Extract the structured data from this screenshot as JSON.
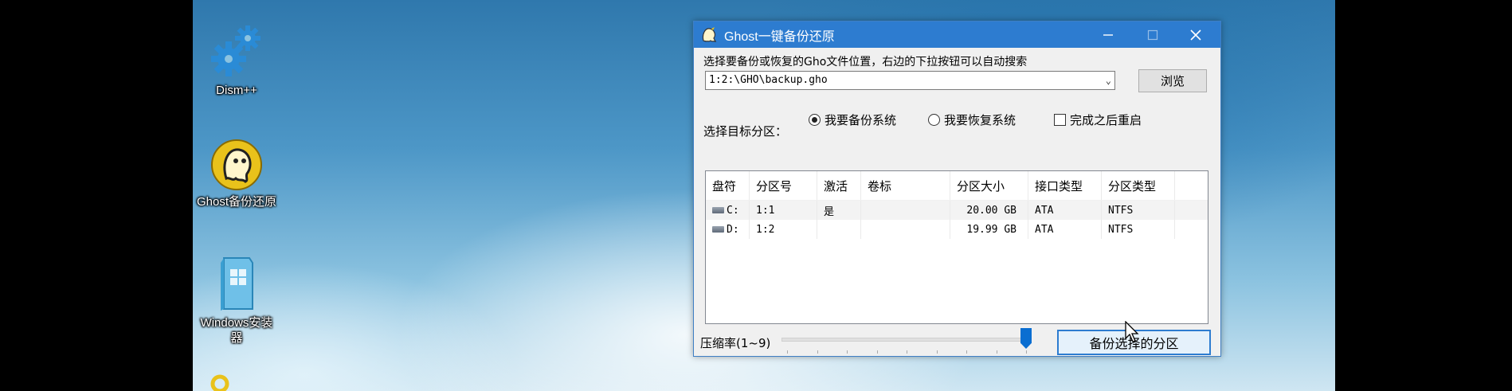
{
  "desktop": {
    "icons": [
      {
        "name": "dism",
        "label": "Dism++"
      },
      {
        "name": "ghost",
        "label": "Ghost备份还原"
      },
      {
        "name": "windows-installer",
        "label": "Windows安装器"
      }
    ]
  },
  "window": {
    "title": "Ghost一键备份还原",
    "prompt": "选择要备份或恢复的Gho文件位置，右边的下拉按钮可以自动搜索",
    "path_value": "1:2:\\GHO\\backup.gho",
    "browse_label": "浏览",
    "target_label": "选择目标分区：",
    "options": {
      "backup": "我要备份系统",
      "restore": "我要恢复系统",
      "reboot": "完成之后重启",
      "selected": "backup"
    },
    "columns": [
      "盘符",
      "分区号",
      "激活",
      "卷标",
      "分区大小",
      "接口类型",
      "分区类型"
    ],
    "rows": [
      {
        "drive": "C:",
        "partition": "1:1",
        "active": "是",
        "label": "",
        "size": "20.00 GB",
        "interface": "ATA",
        "fs": "NTFS"
      },
      {
        "drive": "D:",
        "partition": "1:2",
        "active": "",
        "label": "",
        "size": "19.99 GB",
        "interface": "ATA",
        "fs": "NTFS"
      }
    ],
    "compression_label": "压缩率(1~9)",
    "compression_level": 9,
    "compression_max": 9,
    "backup_button_label": "备份选择的分区"
  },
  "colors": {
    "titlebar": "#2d7cd0",
    "accent": "#0a6ed1"
  }
}
